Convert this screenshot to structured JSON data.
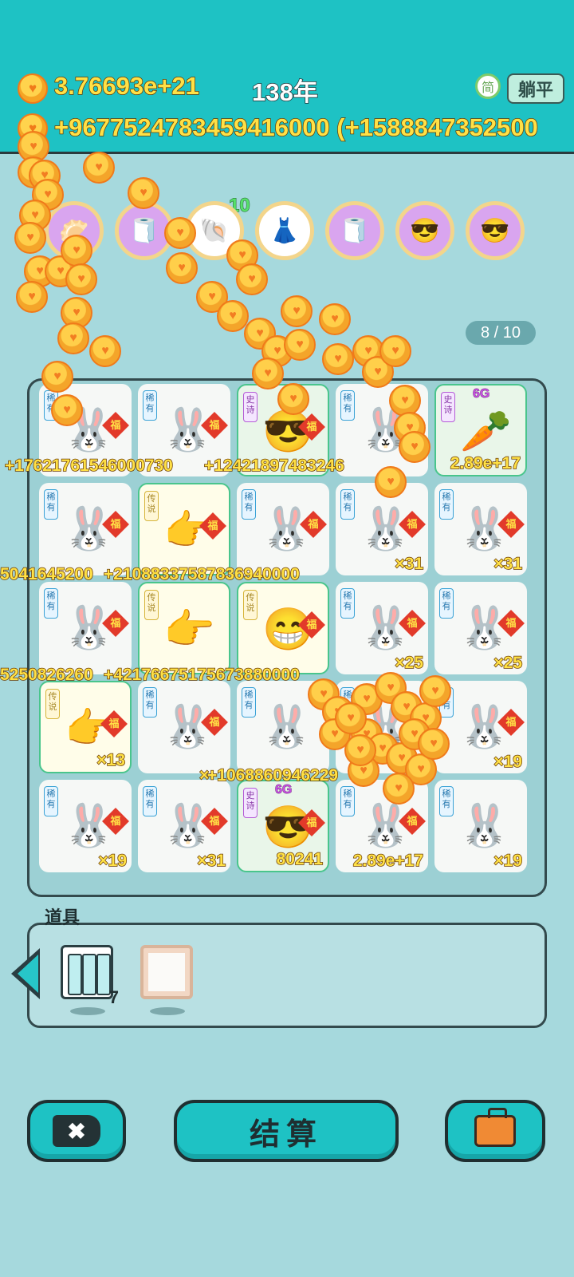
{
  "hud": {
    "money": "3.76693e+21",
    "year": "138年",
    "income": "+9677524783459416000 (+1588847352500",
    "lang_label": "简",
    "flat_label": "躺平",
    "coin_glyph": "♥"
  },
  "badges": {
    "count": "10",
    "items": [
      {
        "icon": "dumpling-icon",
        "glyph": "🥟"
      },
      {
        "icon": "tissue-box-icon",
        "glyph": "🧻"
      },
      {
        "icon": "shell-icon",
        "glyph": "🐚"
      },
      {
        "icon": "skirt-icon",
        "glyph": "👗"
      },
      {
        "icon": "tissue-box-icon",
        "glyph": "🧻"
      },
      {
        "icon": "cool-character-icon",
        "glyph": "😎"
      },
      {
        "icon": "cool-character-icon",
        "glyph": "😎"
      }
    ]
  },
  "pager": "8 / 10",
  "board": {
    "rarity_labels": {
      "rare": "稀有",
      "epic": "史诗",
      "legend": "传说"
    },
    "fu": "福",
    "cells": [
      {
        "type": "rare",
        "sprite": "🐰",
        "fu": true,
        "value": ""
      },
      {
        "type": "rare",
        "sprite": "🐰",
        "fu": true,
        "value": ""
      },
      {
        "type": "epic",
        "sprite": "😎",
        "fu": true,
        "value": ""
      },
      {
        "type": "rare",
        "sprite": "🐰",
        "fu": true,
        "value": ""
      },
      {
        "type": "epic",
        "sprite": "🥕",
        "fu": false,
        "value": "2.89e+17",
        "gen": "6G"
      },
      {
        "type": "rare",
        "sprite": "🐰",
        "fu": true,
        "value": ""
      },
      {
        "type": "legend",
        "sprite": "👉",
        "fu": true,
        "value": ""
      },
      {
        "type": "rare",
        "sprite": "🐰",
        "fu": true,
        "value": ""
      },
      {
        "type": "rare",
        "sprite": "🐰",
        "fu": true,
        "value": "×31"
      },
      {
        "type": "rare",
        "sprite": "🐰",
        "fu": true,
        "value": "×31"
      },
      {
        "type": "rare",
        "sprite": "🐰",
        "fu": true,
        "value": ""
      },
      {
        "type": "legend",
        "sprite": "👉",
        "fu": false,
        "value": ""
      },
      {
        "type": "legend",
        "sprite": "😁",
        "fu": true,
        "value": ""
      },
      {
        "type": "rare",
        "sprite": "🐰",
        "fu": true,
        "value": "×25"
      },
      {
        "type": "rare",
        "sprite": "🐰",
        "fu": true,
        "value": "×25"
      },
      {
        "type": "legend",
        "sprite": "👉",
        "fu": true,
        "value": "×13"
      },
      {
        "type": "rare",
        "sprite": "🐰",
        "fu": true,
        "value": ""
      },
      {
        "type": "rare",
        "sprite": "🐰",
        "fu": false,
        "value": ""
      },
      {
        "type": "rare",
        "sprite": "🐰",
        "fu": false,
        "value": ""
      },
      {
        "type": "rare",
        "sprite": "🐰",
        "fu": true,
        "value": "×19"
      },
      {
        "type": "rare",
        "sprite": "🐰",
        "fu": true,
        "value": "×19"
      },
      {
        "type": "rare",
        "sprite": "🐰",
        "fu": true,
        "value": "×31"
      },
      {
        "type": "epic",
        "sprite": "😎",
        "fu": true,
        "value": "80241",
        "gen": "6G"
      },
      {
        "type": "rare",
        "sprite": "🐰",
        "fu": true,
        "value": "2.89e+17"
      },
      {
        "type": "rare",
        "sprite": "🐰",
        "fu": false,
        "value": "×19"
      }
    ],
    "floating_texts": [
      "+17621761546000730",
      "+12421897483246",
      "5041645200",
      "+21088337587836940000",
      "5250826260",
      "+42176675175673880000",
      "×",
      "+1068860946229"
    ]
  },
  "props": {
    "title": "道具",
    "items": [
      {
        "icon": "battery-icon",
        "count": "7"
      },
      {
        "icon": "frame-icon",
        "count": ""
      }
    ]
  },
  "buttons": {
    "close": "✖",
    "settle": "结算",
    "bag": "briefcase-icon"
  }
}
